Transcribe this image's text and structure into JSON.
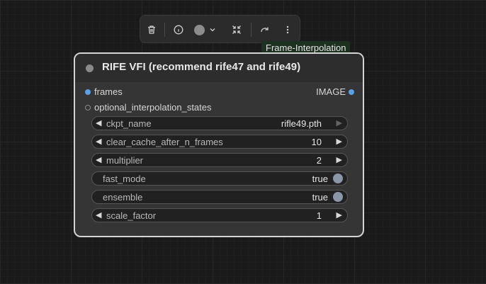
{
  "toolbar": {
    "icons": [
      "trash-icon",
      "info-icon",
      "color-swatch",
      "chevron-down-icon",
      "collapse-icon",
      "redo-icon",
      "more-vertical-icon"
    ],
    "swatch_color": "#8c8c8c"
  },
  "tag": {
    "label": "Frame-Interpolation"
  },
  "node": {
    "title": "RIFE VFI (recommend rife47 and rife49)",
    "inputs": [
      {
        "label": "frames",
        "color": "#5aa0e6"
      },
      {
        "label": "optional_interpolation_states",
        "color": "#8a8a8a"
      }
    ],
    "output": {
      "label": "IMAGE",
      "color": "#5aa0e6"
    },
    "widgets": {
      "ckpt_name": {
        "label": "ckpt_name",
        "value": "rifle49.pth"
      },
      "clear_cache": {
        "label": "clear_cache_after_n_frames",
        "value": "10"
      },
      "multiplier": {
        "label": "multiplier",
        "value": "2"
      },
      "fast_mode": {
        "label": "fast_mode",
        "value": "true"
      },
      "ensemble": {
        "label": "ensemble",
        "value": "true"
      },
      "scale_factor": {
        "label": "scale_factor",
        "value": "1"
      }
    },
    "arrows": {
      "left": "◀",
      "right": "▶"
    }
  }
}
